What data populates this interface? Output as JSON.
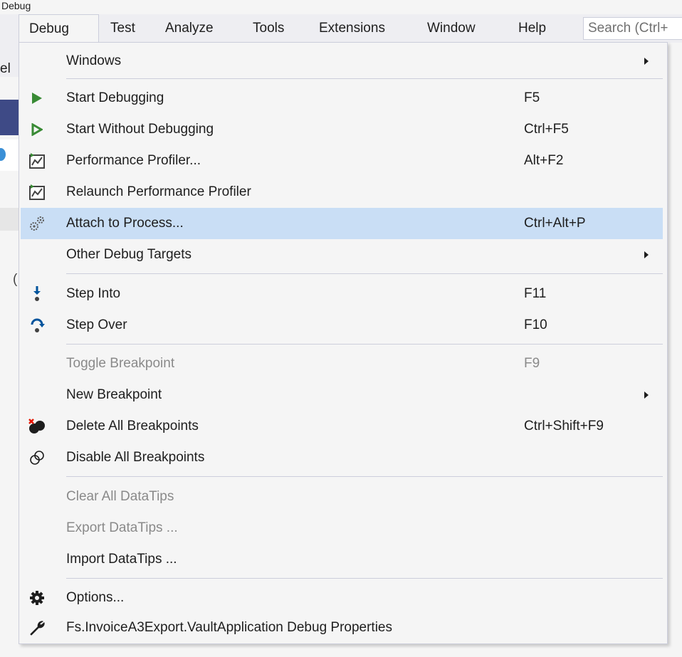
{
  "window": {
    "title_fragment": "Debug"
  },
  "background": {
    "left_fragment": "el",
    "paren_fragment": "("
  },
  "menubar": {
    "items": [
      {
        "label": "Debug"
      },
      {
        "label": "Test"
      },
      {
        "label": "Analyze"
      },
      {
        "label": "Tools"
      },
      {
        "label": "Extensions"
      },
      {
        "label": "Window"
      },
      {
        "label": "Help"
      }
    ],
    "search_text": "Search (Ctrl+"
  },
  "menu": {
    "items": [
      {
        "label": "Windows",
        "shortcut": "",
        "icon": "",
        "submenu": true
      },
      {
        "label": "Start Debugging",
        "shortcut": "F5",
        "icon": "play-icon"
      },
      {
        "label": "Start Without Debugging",
        "shortcut": "Ctrl+F5",
        "icon": "play-outline-icon"
      },
      {
        "label": "Performance Profiler...",
        "shortcut": "Alt+F2",
        "icon": "profiler-icon"
      },
      {
        "label": "Relaunch Performance Profiler",
        "shortcut": "",
        "icon": "profiler-icon"
      },
      {
        "label": "Attach to Process...",
        "shortcut": "Ctrl+Alt+P",
        "icon": "gears-icon",
        "highlighted": true
      },
      {
        "label": "Other Debug Targets",
        "shortcut": "",
        "icon": "",
        "submenu": true
      },
      {
        "label": "Step Into",
        "shortcut": "F11",
        "icon": "step-into-icon"
      },
      {
        "label": "Step Over",
        "shortcut": "F10",
        "icon": "step-over-icon"
      },
      {
        "label": "Toggle Breakpoint",
        "shortcut": "F9",
        "icon": "",
        "disabled": true
      },
      {
        "label": "New Breakpoint",
        "shortcut": "",
        "icon": "",
        "submenu": true
      },
      {
        "label": "Delete All Breakpoints",
        "shortcut": "Ctrl+Shift+F9",
        "icon": "delete-breakpoints-icon"
      },
      {
        "label": "Disable All Breakpoints",
        "shortcut": "",
        "icon": "disable-breakpoints-icon"
      },
      {
        "label": "Clear All DataTips",
        "shortcut": "",
        "icon": "",
        "disabled": true
      },
      {
        "label": "Export DataTips ...",
        "shortcut": "",
        "icon": "",
        "disabled": true
      },
      {
        "label": "Import DataTips ...",
        "shortcut": "",
        "icon": ""
      },
      {
        "label": "Options...",
        "shortcut": "",
        "icon": "gear-icon"
      },
      {
        "label": "Fs.InvoiceA3Export.VaultApplication Debug Properties",
        "shortcut": "",
        "icon": "wrench-icon"
      }
    ]
  },
  "colors": {
    "highlight": "#c9def5",
    "play_green": "#388a34",
    "step_blue": "#00539c",
    "disabled_text": "#8a8a8a"
  }
}
